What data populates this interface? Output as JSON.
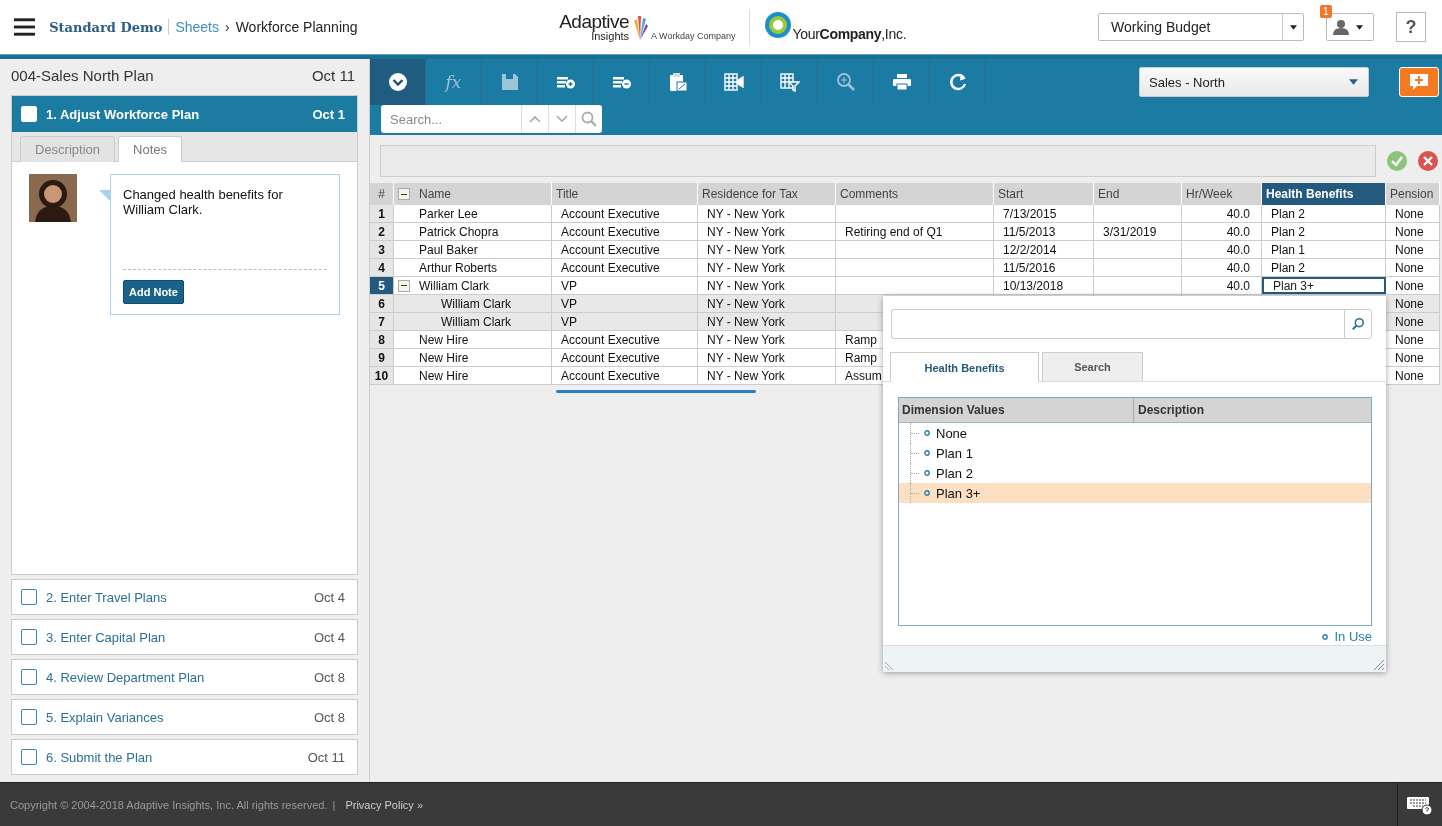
{
  "header": {
    "breadcrumb": [
      {
        "label": "Standard Demo",
        "kind": "home"
      },
      {
        "label": "Sheets",
        "kind": "link"
      },
      {
        "label": "Workforce Planning",
        "kind": "current"
      }
    ],
    "separator": "›",
    "logo": {
      "name": "Adaptive",
      "sub": "Insights",
      "tagline": "A Workday Company"
    },
    "company": "Your**Company**,Inc.",
    "version_select": "Working Budget",
    "notification_count": "1",
    "help": "?"
  },
  "plan": {
    "title": "004-Sales North Plan",
    "date": "Oct 11"
  },
  "tasks": [
    {
      "label": "1. Adjust Workforce Plan",
      "date": "Oct 1",
      "checked": false,
      "expanded": true
    },
    {
      "label": "2. Enter Travel Plans",
      "date": "Oct 4",
      "checked": false,
      "expanded": false
    },
    {
      "label": "3. Enter Capital Plan",
      "date": "Oct 4",
      "checked": false,
      "expanded": false
    },
    {
      "label": "4. Review Department Plan",
      "date": "Oct 8",
      "checked": false,
      "expanded": false
    },
    {
      "label": "5. Explain Variances",
      "date": "Oct 8",
      "checked": false,
      "expanded": false
    },
    {
      "label": "6. Submit the Plan",
      "date": "Oct 11",
      "checked": false,
      "expanded": false
    }
  ],
  "task_tabs": [
    {
      "label": "Description",
      "selected": false
    },
    {
      "label": "Notes",
      "selected": true
    }
  ],
  "note": {
    "text": "Changed health benefits for William Clark.",
    "button": "Add Note"
  },
  "toolbar": {
    "formula_label": "fx",
    "level_select": "Sales - North",
    "search": {
      "placeholder": "Search..."
    }
  },
  "table": {
    "expanded": true,
    "columns": [
      {
        "label": "#",
        "selected": false
      },
      {
        "label": "Name",
        "selected": false
      },
      {
        "label": "Title",
        "selected": false
      },
      {
        "label": "Residence for Tax",
        "selected": false
      },
      {
        "label": "Comments",
        "selected": false
      },
      {
        "label": "Start",
        "selected": false
      },
      {
        "label": "End",
        "selected": false
      },
      {
        "label": "Hr/Week",
        "selected": false
      },
      {
        "label": "Health Benefits",
        "selected": true
      },
      {
        "label": "Pension",
        "selected": false
      }
    ],
    "rows": [
      {
        "num": "1",
        "name": "Parker Lee",
        "title": "Account Executive",
        "residence": "NY - New York",
        "start": "7/13/2015",
        "hours": "40.0",
        "health": "Plan 2",
        "pension": "None",
        "selected": false
      },
      {
        "num": "2",
        "name": "Patrick Chopra",
        "title": "Account Executive",
        "residence": "NY - New York",
        "comments": "Retiring end of Q1",
        "start": "11/5/2013",
        "end": "3/31/2019",
        "hours": "40.0",
        "health": "Plan 2",
        "pension": "None",
        "selected": false
      },
      {
        "num": "3",
        "name": "Paul Baker",
        "title": "Account Executive",
        "residence": "NY - New York",
        "start": "12/2/2014",
        "hours": "40.0",
        "health": "Plan 1",
        "pension": "None",
        "selected": false
      },
      {
        "num": "4",
        "name": "Arthur Roberts",
        "title": "Account Executive",
        "residence": "NY - New York",
        "start": "11/5/2016",
        "hours": "40.0",
        "health": "Plan 2",
        "pension": "None",
        "selected": false
      },
      {
        "num": "5",
        "name": "William Clark",
        "title": "VP",
        "residence": "NY - New York",
        "start": "10/13/2018",
        "hours": "40.0",
        "health": "Plan 3+",
        "pension": "None",
        "selected": true,
        "expanded": true,
        "children": [
          {
            "num": "6",
            "name": "William Clark",
            "title": "VP",
            "residence": "NY - New York",
            "pension": "None",
            "selected": false
          },
          {
            "num": "7",
            "name": "William Clark",
            "title": "VP",
            "residence": "NY - New York",
            "pension": "None",
            "selected": false
          }
        ]
      },
      {
        "num": "8",
        "name": "New Hire",
        "title": "Account Executive",
        "residence": "NY - New York",
        "comments": "Ramp",
        "pension": "None",
        "selected": false
      },
      {
        "num": "9",
        "name": "New Hire",
        "title": "Account Executive",
        "residence": "NY - New York",
        "comments": "Ramp",
        "pension": "None",
        "selected": false
      },
      {
        "num": "10",
        "name": "New Hire",
        "title": "Account Executive",
        "residence": "NY - New York",
        "comments": "Assum",
        "pension": "None",
        "selected": false
      }
    ]
  },
  "picker": {
    "tabs": [
      {
        "label": "Health Benefits",
        "selected": true
      },
      {
        "label": "Search",
        "selected": false
      }
    ],
    "columns": [
      "Dimension Values",
      "Description"
    ],
    "items": [
      {
        "label": "None",
        "selected": false
      },
      {
        "label": "Plan 1",
        "selected": false
      },
      {
        "label": "Plan 2",
        "selected": false
      },
      {
        "label": "Plan 3+",
        "selected": true
      }
    ],
    "legend": "In Use"
  },
  "footer": {
    "copyright": "Copyright © 2004-2018 Adaptive Insights, Inc. All rights reserved.",
    "separator": "|",
    "link": "Privacy Policy »"
  }
}
